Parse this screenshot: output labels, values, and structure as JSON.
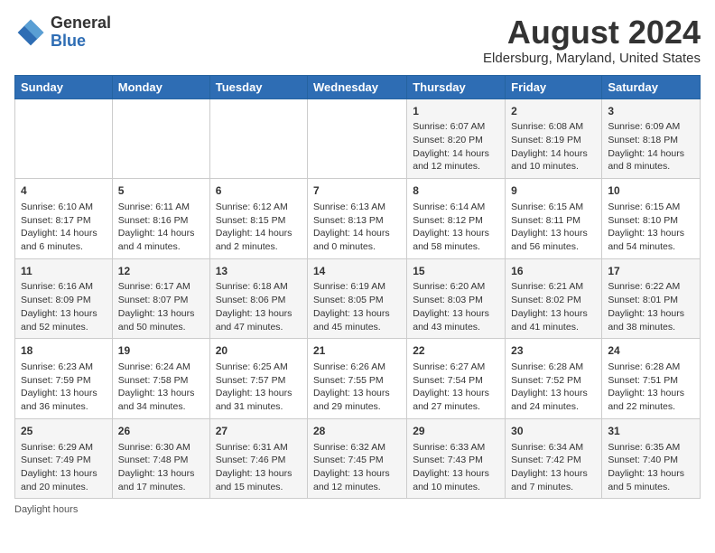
{
  "logo": {
    "general": "General",
    "blue": "Blue"
  },
  "title": {
    "month_year": "August 2024",
    "location": "Eldersburg, Maryland, United States"
  },
  "days_of_week": [
    "Sunday",
    "Monday",
    "Tuesday",
    "Wednesday",
    "Thursday",
    "Friday",
    "Saturday"
  ],
  "weeks": [
    [
      {
        "day": "",
        "info": ""
      },
      {
        "day": "",
        "info": ""
      },
      {
        "day": "",
        "info": ""
      },
      {
        "day": "",
        "info": ""
      },
      {
        "day": "1",
        "info": "Sunrise: 6:07 AM\nSunset: 8:20 PM\nDaylight: 14 hours and 12 minutes."
      },
      {
        "day": "2",
        "info": "Sunrise: 6:08 AM\nSunset: 8:19 PM\nDaylight: 14 hours and 10 minutes."
      },
      {
        "day": "3",
        "info": "Sunrise: 6:09 AM\nSunset: 8:18 PM\nDaylight: 14 hours and 8 minutes."
      }
    ],
    [
      {
        "day": "4",
        "info": "Sunrise: 6:10 AM\nSunset: 8:17 PM\nDaylight: 14 hours and 6 minutes."
      },
      {
        "day": "5",
        "info": "Sunrise: 6:11 AM\nSunset: 8:16 PM\nDaylight: 14 hours and 4 minutes."
      },
      {
        "day": "6",
        "info": "Sunrise: 6:12 AM\nSunset: 8:15 PM\nDaylight: 14 hours and 2 minutes."
      },
      {
        "day": "7",
        "info": "Sunrise: 6:13 AM\nSunset: 8:13 PM\nDaylight: 14 hours and 0 minutes."
      },
      {
        "day": "8",
        "info": "Sunrise: 6:14 AM\nSunset: 8:12 PM\nDaylight: 13 hours and 58 minutes."
      },
      {
        "day": "9",
        "info": "Sunrise: 6:15 AM\nSunset: 8:11 PM\nDaylight: 13 hours and 56 minutes."
      },
      {
        "day": "10",
        "info": "Sunrise: 6:15 AM\nSunset: 8:10 PM\nDaylight: 13 hours and 54 minutes."
      }
    ],
    [
      {
        "day": "11",
        "info": "Sunrise: 6:16 AM\nSunset: 8:09 PM\nDaylight: 13 hours and 52 minutes."
      },
      {
        "day": "12",
        "info": "Sunrise: 6:17 AM\nSunset: 8:07 PM\nDaylight: 13 hours and 50 minutes."
      },
      {
        "day": "13",
        "info": "Sunrise: 6:18 AM\nSunset: 8:06 PM\nDaylight: 13 hours and 47 minutes."
      },
      {
        "day": "14",
        "info": "Sunrise: 6:19 AM\nSunset: 8:05 PM\nDaylight: 13 hours and 45 minutes."
      },
      {
        "day": "15",
        "info": "Sunrise: 6:20 AM\nSunset: 8:03 PM\nDaylight: 13 hours and 43 minutes."
      },
      {
        "day": "16",
        "info": "Sunrise: 6:21 AM\nSunset: 8:02 PM\nDaylight: 13 hours and 41 minutes."
      },
      {
        "day": "17",
        "info": "Sunrise: 6:22 AM\nSunset: 8:01 PM\nDaylight: 13 hours and 38 minutes."
      }
    ],
    [
      {
        "day": "18",
        "info": "Sunrise: 6:23 AM\nSunset: 7:59 PM\nDaylight: 13 hours and 36 minutes."
      },
      {
        "day": "19",
        "info": "Sunrise: 6:24 AM\nSunset: 7:58 PM\nDaylight: 13 hours and 34 minutes."
      },
      {
        "day": "20",
        "info": "Sunrise: 6:25 AM\nSunset: 7:57 PM\nDaylight: 13 hours and 31 minutes."
      },
      {
        "day": "21",
        "info": "Sunrise: 6:26 AM\nSunset: 7:55 PM\nDaylight: 13 hours and 29 minutes."
      },
      {
        "day": "22",
        "info": "Sunrise: 6:27 AM\nSunset: 7:54 PM\nDaylight: 13 hours and 27 minutes."
      },
      {
        "day": "23",
        "info": "Sunrise: 6:28 AM\nSunset: 7:52 PM\nDaylight: 13 hours and 24 minutes."
      },
      {
        "day": "24",
        "info": "Sunrise: 6:28 AM\nSunset: 7:51 PM\nDaylight: 13 hours and 22 minutes."
      }
    ],
    [
      {
        "day": "25",
        "info": "Sunrise: 6:29 AM\nSunset: 7:49 PM\nDaylight: 13 hours and 20 minutes."
      },
      {
        "day": "26",
        "info": "Sunrise: 6:30 AM\nSunset: 7:48 PM\nDaylight: 13 hours and 17 minutes."
      },
      {
        "day": "27",
        "info": "Sunrise: 6:31 AM\nSunset: 7:46 PM\nDaylight: 13 hours and 15 minutes."
      },
      {
        "day": "28",
        "info": "Sunrise: 6:32 AM\nSunset: 7:45 PM\nDaylight: 13 hours and 12 minutes."
      },
      {
        "day": "29",
        "info": "Sunrise: 6:33 AM\nSunset: 7:43 PM\nDaylight: 13 hours and 10 minutes."
      },
      {
        "day": "30",
        "info": "Sunrise: 6:34 AM\nSunset: 7:42 PM\nDaylight: 13 hours and 7 minutes."
      },
      {
        "day": "31",
        "info": "Sunrise: 6:35 AM\nSunset: 7:40 PM\nDaylight: 13 hours and 5 minutes."
      }
    ]
  ],
  "footer": {
    "note": "Daylight hours"
  }
}
